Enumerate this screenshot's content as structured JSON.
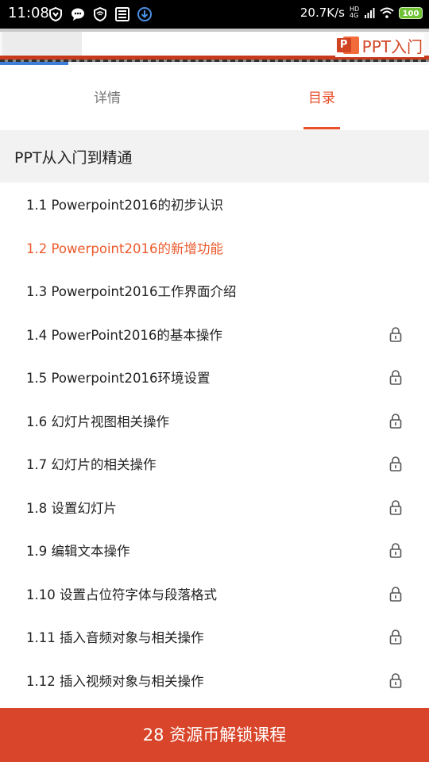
{
  "status_bar": {
    "time": "11:08",
    "net_speed": "20.7K/s",
    "network_type": "HD 4G",
    "battery": "100",
    "icons_left": [
      "shield-icon",
      "chat-icon",
      "vpn-shield-icon",
      "film-icon",
      "download-icon"
    ]
  },
  "banner": {
    "logo_badge": "P",
    "logo_text": "PPT入门"
  },
  "tabs": [
    {
      "label": "详情",
      "active": false
    },
    {
      "label": "目录",
      "active": true
    }
  ],
  "course": {
    "title": "PPT从入门到精通"
  },
  "chapters": [
    {
      "label": "1.1 Powerpoint2016的初步认识",
      "locked": false,
      "current": false
    },
    {
      "label": "1.2 Powerpoint2016的新增功能",
      "locked": false,
      "current": true
    },
    {
      "label": "1.3 Powerpoint2016工作界面介绍",
      "locked": false,
      "current": false
    },
    {
      "label": "1.4 PowerPoint2016的基本操作",
      "locked": true,
      "current": false
    },
    {
      "label": "1.5 Powerpoint2016环境设置",
      "locked": true,
      "current": false
    },
    {
      "label": "1.6 幻灯片视图相关操作",
      "locked": true,
      "current": false
    },
    {
      "label": "1.7 幻灯片的相关操作",
      "locked": true,
      "current": false
    },
    {
      "label": "1.8 设置幻灯片",
      "locked": true,
      "current": false
    },
    {
      "label": "1.9 编辑文本操作",
      "locked": true,
      "current": false
    },
    {
      "label": "1.10 设置占位符字体与段落格式",
      "locked": true,
      "current": false
    },
    {
      "label": "1.11 插入音频对象与相关操作",
      "locked": true,
      "current": false
    },
    {
      "label": "1.12 插入视频对象与相关操作",
      "locked": true,
      "current": false
    }
  ],
  "unlock_button": {
    "label": "28 资源币解锁课程"
  },
  "colors": {
    "accent": "#e8502a",
    "unlock_bar": "#d8452a",
    "section_bg": "#f2f2f2"
  }
}
